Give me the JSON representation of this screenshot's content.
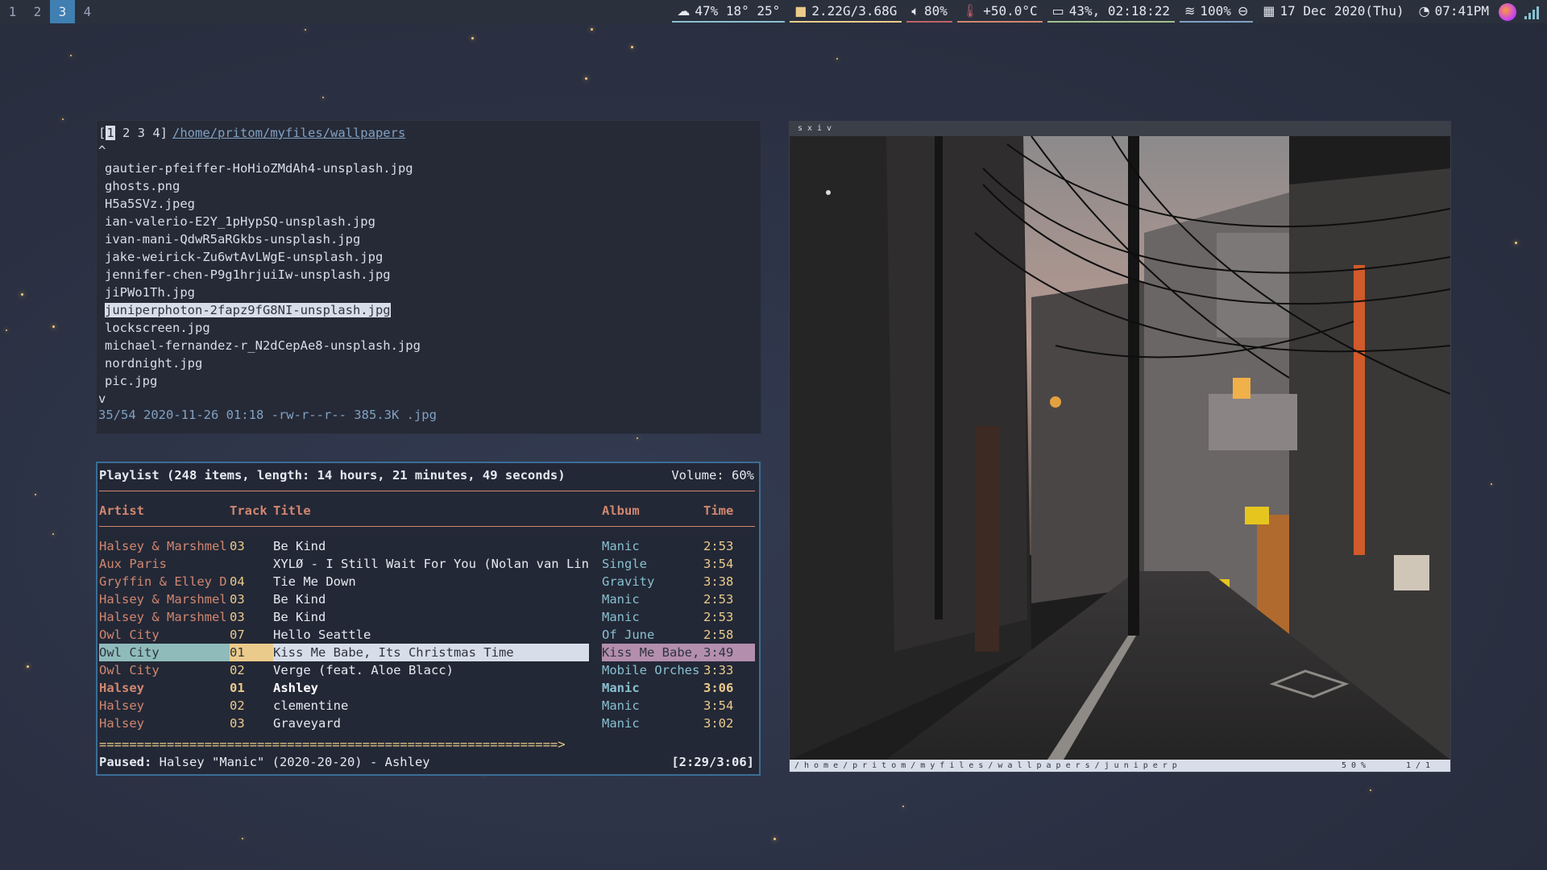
{
  "workspaces": [
    {
      "label": "1",
      "active": false
    },
    {
      "label": "2",
      "active": false
    },
    {
      "label": "3",
      "active": true
    },
    {
      "label": "4",
      "active": false
    }
  ],
  "statusbar": {
    "weather": "47%  18°  25°",
    "memory": "2.22G/3.68G",
    "volume": "80%",
    "temperature": "+50.0°C",
    "battery": "43%, 02:18:22",
    "wifi": "100%",
    "date": "17 Dec 2020(Thu)",
    "time": "07:41PM"
  },
  "ranger": {
    "tabs_open": "[",
    "tab_current": "1",
    "tabs_rest": " 2 3 4]",
    "path": "/home/pritom/myfiles/wallpapers",
    "scroll_up": "^",
    "scroll_down": "v",
    "files": [
      "gautier-pfeiffer-HoHioZMdAh4-unsplash.jpg",
      "ghosts.png",
      "H5a5SVz.jpeg",
      "ian-valerio-E2Y_1pHypSQ-unsplash.jpg",
      "ivan-mani-QdwR5aRGkbs-unsplash.jpg",
      "jake-weirick-Zu6wtAvLWgE-unsplash.jpg",
      "jennifer-chen-P9g1hrjuiIw-unsplash.jpg",
      "jiPWo1Th.jpg",
      "juniperphoton-2fapz9fG8NI-unsplash.jpg",
      "lockscreen.jpg",
      "michael-fernandez-r_N2dCepAe8-unsplash.jpg",
      "nordnight.jpg",
      "pic.jpg"
    ],
    "selected_index": 8,
    "status": "35/54 2020-11-26 01:18 -rw-r--r-- 385.3K .jpg"
  },
  "ncmpcpp": {
    "playlist_header": "Playlist (248 items, length: 14 hours, 21 minutes, 49 seconds)",
    "volume": "Volume: 60%",
    "columns": {
      "artist": "Artist",
      "track": "Track",
      "title": "Title",
      "album": "Album",
      "time": "Time"
    },
    "rows": [
      {
        "artist": "Halsey & Marshmel",
        "track": "03",
        "title": "Be Kind",
        "album": "Manic",
        "time": "2:53",
        "state": ""
      },
      {
        "artist": "Aux Paris",
        "track": "",
        "title": "XYLØ - I Still Wait For You (Nolan van Linth",
        "album": "Single",
        "time": "3:54",
        "state": ""
      },
      {
        "artist": "Gryffin & Elley D",
        "track": "04",
        "title": "Tie Me Down",
        "album": "Gravity",
        "time": "3:38",
        "state": ""
      },
      {
        "artist": "Halsey & Marshmel",
        "track": "03",
        "title": "Be Kind",
        "album": "Manic",
        "time": "2:53",
        "state": ""
      },
      {
        "artist": "Halsey & Marshmel",
        "track": "03",
        "title": "Be Kind",
        "album": "Manic",
        "time": "2:53",
        "state": ""
      },
      {
        "artist": "Owl City",
        "track": "07",
        "title": "Hello Seattle",
        "album": "Of June",
        "time": "2:58",
        "state": ""
      },
      {
        "artist": "Owl City",
        "track": "01",
        "title": "Kiss Me Babe, Its Christmas Time",
        "album": "Kiss Me Babe,",
        "time": "3:49",
        "state": "highlight"
      },
      {
        "artist": "Owl City",
        "track": "02",
        "title": "Verge (feat. Aloe Blacc)",
        "album": "Mobile Orches",
        "time": "3:33",
        "state": ""
      },
      {
        "artist": "Halsey",
        "track": "01",
        "title": "Ashley",
        "album": "Manic",
        "time": "3:06",
        "state": "playing"
      },
      {
        "artist": "Halsey",
        "track": "02",
        "title": "clementine",
        "album": "Manic",
        "time": "3:54",
        "state": ""
      },
      {
        "artist": "Halsey",
        "track": "03",
        "title": "Graveyard",
        "album": "Manic",
        "time": "3:02",
        "state": ""
      }
    ],
    "progress_bar": "=============================================================>",
    "progress_fraction": 0.81,
    "state_label": "Paused:",
    "now_playing": " Halsey \"Manic\" (2020-20-20) - Ashley",
    "elapsed": "[2:29/3:06]"
  },
  "sxiv": {
    "title": "sxiv",
    "status_path": "/home/pritom/myfiles/wallpapers/juniperp",
    "zoom": "50%",
    "index": "1/1"
  },
  "colors": {
    "accent": "#3f7fb1",
    "orange": "#d08770",
    "yellow": "#ebcb8b",
    "cyan": "#88c0d0",
    "purple": "#b48ead"
  }
}
